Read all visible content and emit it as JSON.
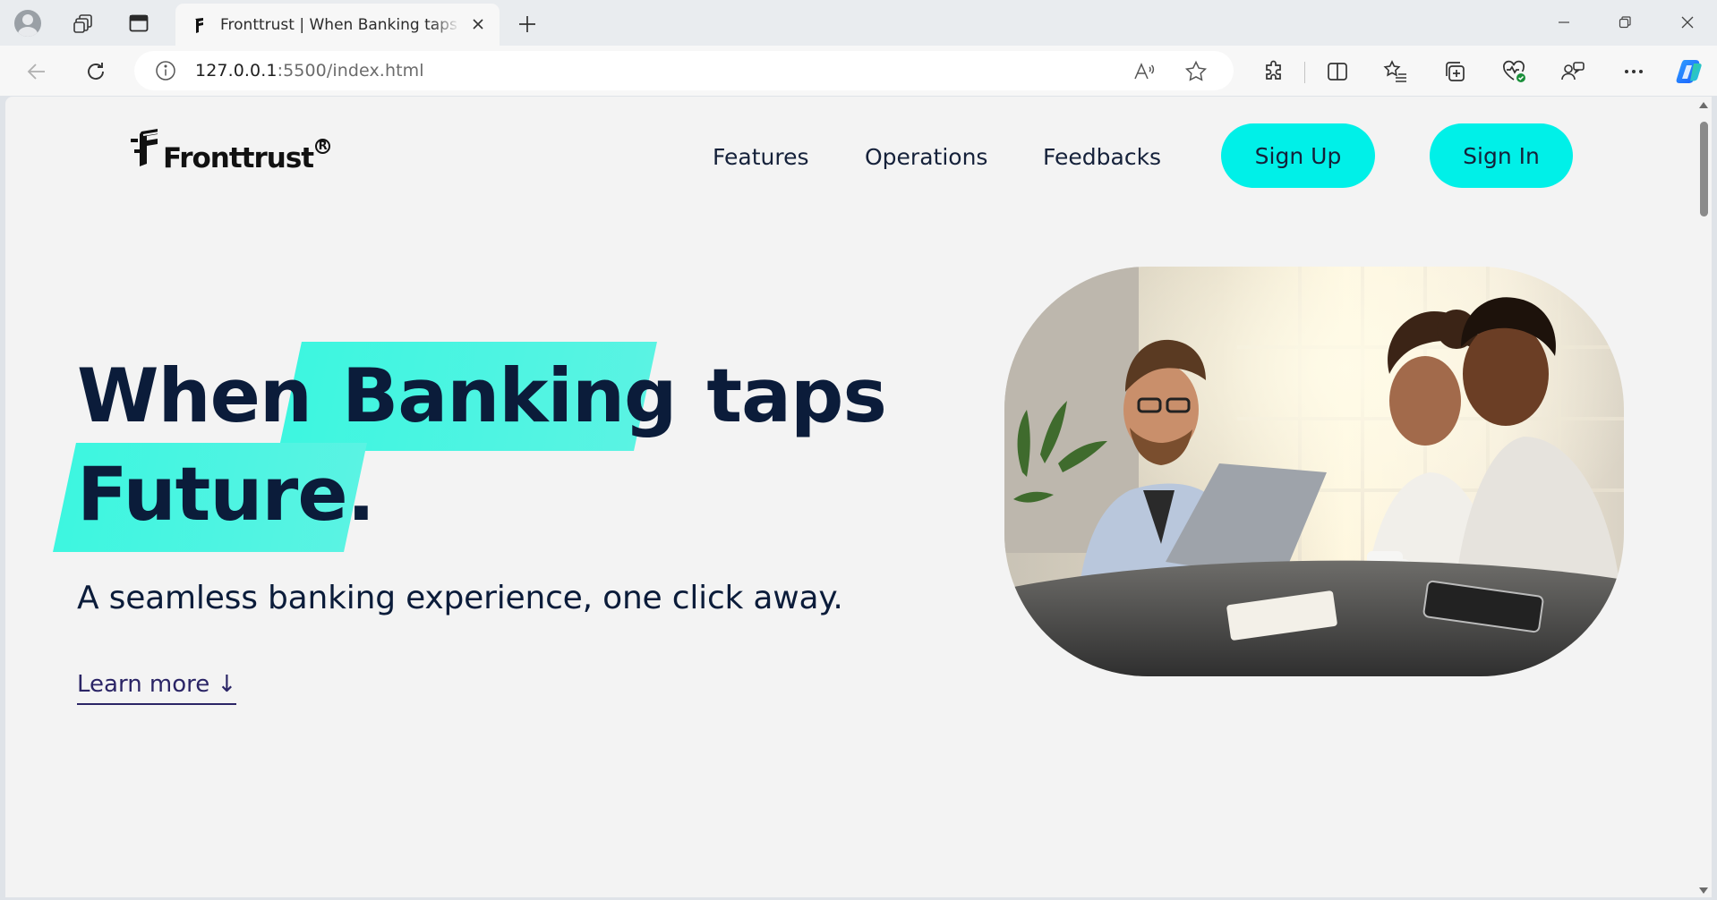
{
  "browser": {
    "tab_title": "Fronttrust | When Banking taps Future.",
    "url_host": "127.0.0.1",
    "url_rest": ":5500/index.html"
  },
  "site": {
    "brand": "Fronttrust",
    "brand_mark": "®",
    "nav": {
      "features": "Features",
      "operations": "Operations",
      "feedbacks": "Feedbacks",
      "signup": "Sign Up",
      "signin": "Sign In"
    },
    "hero": {
      "word1": "When",
      "word2": "Banking",
      "word3": "taps",
      "word4": "Future.",
      "subtitle": "A seamless banking experience, one click away.",
      "learn_more": "Learn more ↓"
    }
  },
  "colors": {
    "accent": "#00f0e8",
    "highlight": "#41f3e0",
    "text_dark": "#0b1c3a"
  }
}
